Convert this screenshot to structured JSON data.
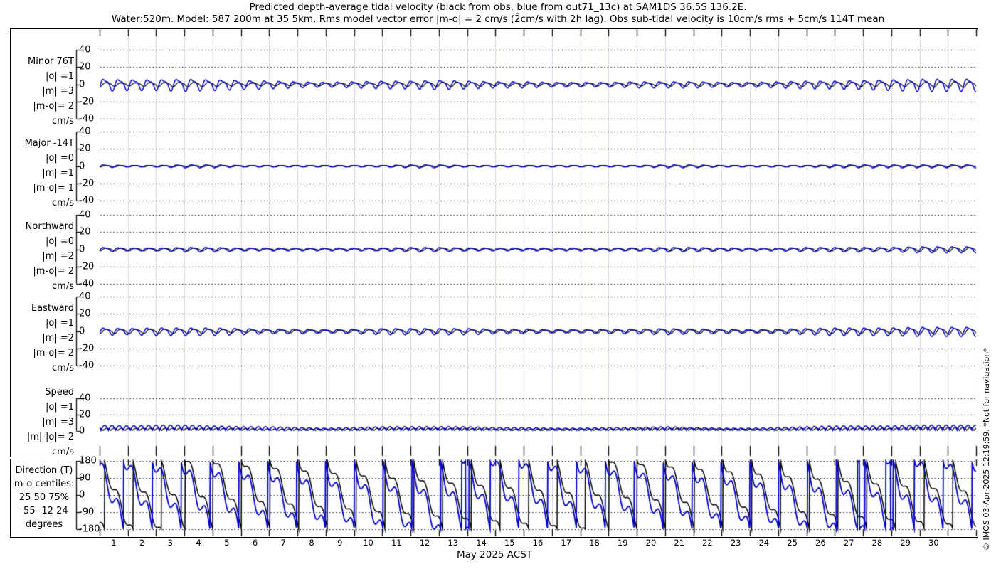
{
  "figure": {
    "title_line1": "Predicted depth-average tidal velocity (black from obs, blue from out71_13c) at SAM1DS 36.5S 136.2E.",
    "title_line2": "Water:520m. Model: 587 200m at 35 5km. Rms model vector error |m-o| = 2 cm/s (2̄cm/s with 2h lag). Obs sub-tidal velocity is 10cm/s rms + 5cm/s 114T mean"
  },
  "watermark": "© IMOS 03-Apr-2025 12:19:59. *Not for navigation*",
  "colors": {
    "obs": "#000000",
    "model": "#0000cc",
    "grid_vertical": "#d6d6e6",
    "grid_dots": "#000000",
    "frame": "#000000",
    "background": "#ffffff"
  },
  "x_axis": {
    "label": "May 2025 ACST",
    "days_span": 31,
    "day_labels": [
      "1",
      "2",
      "3",
      "4",
      "5",
      "6",
      "7",
      "8",
      "9",
      "10",
      "11",
      "12",
      "13",
      "14",
      "15",
      "16",
      "17",
      "18",
      "19",
      "20",
      "21",
      "22",
      "23",
      "24",
      "25",
      "26",
      "27",
      "28",
      "29",
      "30"
    ]
  },
  "chart_data": [
    {
      "id": "minor",
      "type": "line",
      "label_lines": [
        "Minor 76T",
        "|o| =1",
        "|m| =3",
        "|m-o|= 2",
        "cm/s"
      ],
      "ylim": [
        -50,
        50
      ],
      "yticks": [
        40,
        20,
        0,
        -20,
        -40
      ],
      "units": "cm/s",
      "series": [
        {
          "name": "observed (black from obs)",
          "color_key": "obs",
          "kind": "tidal",
          "freq_cpd": 1.932,
          "phase_days": 0.13,
          "asym": 0.25,
          "daily_amplitude_cm_s": [
            3,
            2,
            3,
            3,
            3,
            2,
            2,
            2,
            2,
            2,
            2,
            3,
            3,
            3,
            2,
            2,
            2,
            2,
            2,
            2,
            2,
            3,
            2,
            2,
            2,
            3,
            3,
            3,
            3,
            3,
            4
          ]
        },
        {
          "name": "model out71_13c (blue)",
          "color_key": "model",
          "kind": "tidal",
          "freq_cpd": 1.932,
          "phase_days": 0.05,
          "asym": 0.35,
          "daily_amplitude_cm_s": [
            8,
            7,
            7,
            8,
            7,
            6,
            5,
            4,
            3,
            4,
            5,
            5,
            6,
            5,
            4,
            4,
            3,
            3,
            3,
            4,
            4,
            4,
            3,
            3,
            4,
            5,
            5,
            6,
            7,
            8,
            8
          ]
        }
      ]
    },
    {
      "id": "major",
      "type": "line",
      "label_lines": [
        "Major -14T",
        "|o| =0",
        "|m| =1",
        "|m-o|= 1",
        "cm/s"
      ],
      "ylim": [
        -50,
        50
      ],
      "yticks": [
        40,
        20,
        0,
        -20,
        -40
      ],
      "units": "cm/s",
      "series": [
        {
          "name": "observed (black from obs)",
          "color_key": "obs",
          "kind": "tidal",
          "freq_cpd": 1.932,
          "phase_days": 0.13,
          "asym": 0.2,
          "daily_amplitude_cm_s": [
            1,
            1,
            1,
            1,
            1,
            1,
            1,
            1,
            1,
            1,
            1,
            1,
            1,
            1,
            1,
            1,
            1,
            1,
            1,
            1,
            1,
            1,
            1,
            1,
            1,
            1,
            1,
            1,
            1,
            1,
            1
          ]
        },
        {
          "name": "model out71_13c (blue)",
          "color_key": "model",
          "kind": "tidal",
          "freq_cpd": 1.932,
          "phase_days": 0.05,
          "asym": 0.3,
          "daily_amplitude_cm_s": [
            2,
            1,
            1,
            2,
            2,
            1,
            1,
            1,
            1,
            1,
            1,
            2,
            2,
            1,
            1,
            1,
            1,
            1,
            1,
            1,
            2,
            2,
            1,
            1,
            1,
            1,
            2,
            2,
            2,
            2,
            2
          ]
        }
      ]
    },
    {
      "id": "northward",
      "type": "line",
      "label_lines": [
        "Northward",
        "|o| =0",
        "|m| =2",
        "|m-o|= 2",
        "cm/s"
      ],
      "ylim": [
        -50,
        50
      ],
      "yticks": [
        40,
        20,
        0,
        -20,
        -40
      ],
      "units": "cm/s",
      "series": [
        {
          "name": "observed (black from obs)",
          "color_key": "obs",
          "kind": "tidal",
          "freq_cpd": 1.932,
          "phase_days": 0.13,
          "asym": 0.2,
          "daily_amplitude_cm_s": [
            2,
            2,
            2,
            2,
            2,
            2,
            1,
            1,
            1,
            1,
            2,
            2,
            2,
            2,
            1,
            1,
            1,
            1,
            1,
            2,
            2,
            2,
            2,
            1,
            1,
            2,
            2,
            2,
            2,
            3,
            3
          ]
        },
        {
          "name": "model out71_13c (blue)",
          "color_key": "model",
          "kind": "tidal",
          "freq_cpd": 1.932,
          "phase_days": 0.05,
          "asym": 0.3,
          "daily_amplitude_cm_s": [
            3,
            2,
            2,
            3,
            3,
            2,
            2,
            2,
            2,
            2,
            2,
            3,
            3,
            2,
            2,
            2,
            2,
            2,
            2,
            2,
            3,
            3,
            2,
            2,
            2,
            3,
            3,
            3,
            3,
            4,
            4
          ]
        }
      ]
    },
    {
      "id": "eastward",
      "type": "line",
      "label_lines": [
        "Eastward",
        "|o| =1",
        "|m| =2",
        "|m-o|= 2",
        "cm/s"
      ],
      "ylim": [
        -50,
        50
      ],
      "yticks": [
        40,
        20,
        0,
        -20,
        -40
      ],
      "units": "cm/s",
      "series": [
        {
          "name": "observed (black from obs)",
          "color_key": "obs",
          "kind": "tidal",
          "freq_cpd": 1.932,
          "phase_days": 0.13,
          "asym": 0.25,
          "daily_amplitude_cm_s": [
            3,
            3,
            3,
            3,
            3,
            2,
            2,
            2,
            2,
            2,
            3,
            3,
            3,
            2,
            2,
            2,
            2,
            2,
            2,
            2,
            3,
            3,
            2,
            2,
            2,
            3,
            3,
            3,
            3,
            4,
            4
          ]
        },
        {
          "name": "model out71_13c (blue)",
          "color_key": "model",
          "kind": "tidal",
          "freq_cpd": 1.932,
          "phase_days": 0.05,
          "asym": 0.35,
          "daily_amplitude_cm_s": [
            5,
            4,
            5,
            5,
            5,
            4,
            3,
            3,
            2,
            3,
            4,
            4,
            4,
            4,
            3,
            3,
            2,
            2,
            3,
            3,
            4,
            3,
            3,
            2,
            3,
            4,
            5,
            5,
            5,
            6,
            6
          ]
        }
      ]
    },
    {
      "id": "speed",
      "type": "line",
      "label_lines": [
        "Speed",
        "|o| =1",
        "|m| =3",
        "|m|-|o|= 2",
        "cm/s"
      ],
      "ylim": [
        0,
        50
      ],
      "yticks": [
        40,
        20,
        0
      ],
      "units": "cm/s",
      "series": [
        {
          "name": "observed (black from obs)",
          "color_key": "obs",
          "kind": "speed",
          "freq_cpd": 1.932,
          "phase_days": 0.13,
          "daily_amplitude_cm_s": [
            3,
            3,
            3,
            3,
            3,
            3,
            2,
            2,
            2,
            2,
            3,
            3,
            3,
            3,
            2,
            2,
            2,
            2,
            2,
            3,
            3,
            3,
            2,
            2,
            2,
            3,
            3,
            3,
            3,
            4,
            4
          ]
        },
        {
          "name": "model out71_13c (blue)",
          "color_key": "model",
          "kind": "speed",
          "freq_cpd": 1.932,
          "phase_days": 0.05,
          "daily_amplitude_cm_s": [
            7,
            6,
            7,
            7,
            6,
            5,
            5,
            4,
            3,
            4,
            5,
            5,
            5,
            5,
            4,
            4,
            3,
            3,
            4,
            4,
            5,
            4,
            3,
            3,
            4,
            5,
            6,
            6,
            6,
            7,
            7
          ]
        }
      ]
    },
    {
      "id": "direction",
      "type": "line",
      "label_lines": [
        "Direction (T)",
        "m-o centiles:",
        "25  50  75%",
        "-55 -12  24",
        "degrees"
      ],
      "ylim": [
        -200,
        200
      ],
      "yticks": [
        180,
        90,
        0,
        -90,
        -180
      ],
      "units": "degrees",
      "series": [
        {
          "name": "observed (black from obs)",
          "color_key": "obs",
          "kind": "direction",
          "rotation_deg_per_day": 360,
          "phase_days": 0.18,
          "wiggle_deg": 32,
          "wiggle_freq_cpd": 1.932
        },
        {
          "name": "model out71_13c (blue)",
          "color_key": "model",
          "kind": "direction",
          "rotation_deg_per_day": 360,
          "phase_days": 0.02,
          "wiggle_deg": 48,
          "wiggle_freq_cpd": 1.932
        }
      ]
    }
  ]
}
